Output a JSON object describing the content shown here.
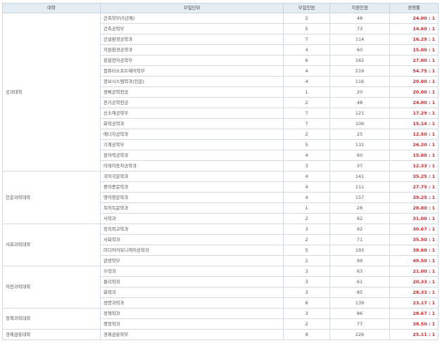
{
  "headers": {
    "college": "대학",
    "unit": "모집단위",
    "quota": "모집인원",
    "applicants": "지원인원",
    "rate": "경쟁률"
  },
  "groups": [
    {
      "college": "공과대학",
      "rows": [
        {
          "unit": "건축학부(5년제)",
          "quota": "2",
          "applicants": "48",
          "rate": "24.00 : 1"
        },
        {
          "unit": "건축공학부",
          "quota": "5",
          "applicants": "73",
          "rate": "14.60 : 1"
        },
        {
          "unit": "건설환경공학과",
          "quota": "7",
          "applicants": "114",
          "rate": "16.29 : 1"
        },
        {
          "unit": "자원환경공학과",
          "quota": "4",
          "applicants": "60",
          "rate": "15.00 : 1"
        },
        {
          "unit": "융합전자공학부",
          "quota": "6",
          "applicants": "162",
          "rate": "27.00 : 1"
        },
        {
          "unit": "컴퓨터소프트웨어학부",
          "quota": "4",
          "applicants": "219",
          "rate": "54.75 : 1"
        },
        {
          "unit": "정보시스템학과(인문)",
          "quota": "4",
          "applicants": "116",
          "rate": "29.00 : 1"
        },
        {
          "unit": "생체공학전공",
          "quota": "1",
          "applicants": "20",
          "rate": "20.00 : 1"
        },
        {
          "unit": "전기공학전공",
          "quota": "2",
          "applicants": "48",
          "rate": "24.00 : 1"
        },
        {
          "unit": "신소재공학부",
          "quota": "7",
          "applicants": "121",
          "rate": "17.29 : 1"
        },
        {
          "unit": "화학공학과",
          "quota": "7",
          "applicants": "106",
          "rate": "15.14 : 1"
        },
        {
          "unit": "에너지공학과",
          "quota": "2",
          "applicants": "25",
          "rate": "12.50 : 1"
        },
        {
          "unit": "기계공학부",
          "quota": "5",
          "applicants": "131",
          "rate": "26.20 : 1"
        },
        {
          "unit": "원자력공학과",
          "quota": "4",
          "applicants": "60",
          "rate": "15.00 : 1"
        },
        {
          "unit": "미래자동차공학과",
          "quota": "3",
          "applicants": "37",
          "rate": "12.33 : 1"
        }
      ]
    },
    {
      "college": "인문과학대학",
      "rows": [
        {
          "unit": "국어국문학과",
          "quota": "4",
          "applicants": "141",
          "rate": "35.25 : 1"
        },
        {
          "unit": "중어중문학과",
          "quota": "4",
          "applicants": "111",
          "rate": "27.75 : 1"
        },
        {
          "unit": "영어영문학과",
          "quota": "4",
          "applicants": "157",
          "rate": "39.25 : 1"
        },
        {
          "unit": "독어독문학과",
          "quota": "1",
          "applicants": "28",
          "rate": "28.00 : 1"
        },
        {
          "unit": "사학과",
          "quota": "2",
          "applicants": "62",
          "rate": "31.00 : 1"
        }
      ]
    },
    {
      "college": "사회과학대학",
      "rows": [
        {
          "unit": "정치외교학과",
          "quota": "3",
          "applicants": "92",
          "rate": "30.67 : 1"
        },
        {
          "unit": "사회학과",
          "quota": "2",
          "applicants": "71",
          "rate": "35.50 : 1"
        },
        {
          "unit": "미디어커뮤니케이션학과",
          "quota": "5",
          "applicants": "193",
          "rate": "38.60 : 1"
        },
        {
          "unit": "관광학부",
          "quota": "2",
          "applicants": "99",
          "rate": "49.50 : 1"
        }
      ]
    },
    {
      "college": "자연과학대학",
      "rows": [
        {
          "unit": "수학과",
          "quota": "3",
          "applicants": "63",
          "rate": "21.00 : 1"
        },
        {
          "unit": "물리학과",
          "quota": "3",
          "applicants": "61",
          "rate": "20.33 : 1"
        },
        {
          "unit": "화학과",
          "quota": "3",
          "applicants": "85",
          "rate": "28.33 : 1"
        },
        {
          "unit": "생명과학과",
          "quota": "6",
          "applicants": "139",
          "rate": "23.17 : 1"
        }
      ]
    },
    {
      "college": "정책과학대학",
      "rows": [
        {
          "unit": "정책학과",
          "quota": "3",
          "applicants": "86",
          "rate": "28.67 : 1"
        },
        {
          "unit": "행정학과",
          "quota": "2",
          "applicants": "77",
          "rate": "38.50 : 1"
        }
      ]
    },
    {
      "college": "경제금융대학",
      "rows": [
        {
          "unit": "경제금융학부",
          "quota": "9",
          "applicants": "226",
          "rate": "25.11 : 1"
        }
      ]
    }
  ]
}
